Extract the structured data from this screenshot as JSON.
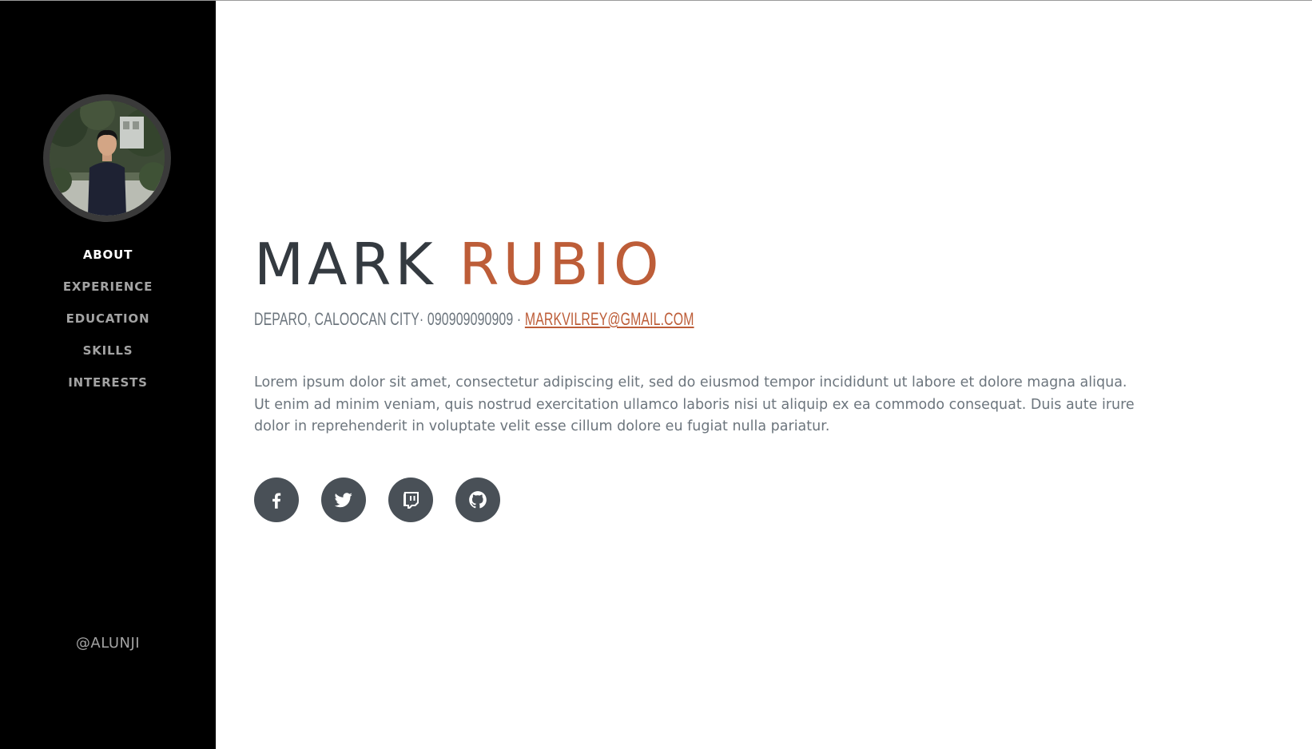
{
  "sidebar": {
    "nav": [
      {
        "label": "ABOUT",
        "active": true
      },
      {
        "label": "EXPERIENCE",
        "active": false
      },
      {
        "label": "EDUCATION",
        "active": false
      },
      {
        "label": "SKILLS",
        "active": false
      },
      {
        "label": "INTERESTS",
        "active": false
      }
    ],
    "handle": "@ALUNJI"
  },
  "about": {
    "first_name": "MARK",
    "last_name": "RUBIO",
    "address": "DEPARO, CALOOCAN CITY· 090909090909 · ",
    "email": "MARKVILREY@GMAIL.COM",
    "intro": "Lorem ipsum dolor sit amet, consectetur adipiscing elit, sed do eiusmod tempor incididunt ut labore et dolore magna aliqua. Ut enim ad minim veniam, quis nostrud exercitation ullamco laboris nisi ut aliquip ex ea commodo consequat. Duis aute irure dolor in reprehenderit in voluptate velit esse cillum dolore eu fugiat nulla pariatur."
  },
  "social": [
    {
      "icon": "facebook-icon"
    },
    {
      "icon": "twitter-icon"
    },
    {
      "icon": "twitch-icon"
    },
    {
      "icon": "github-icon"
    }
  ],
  "colors": {
    "sidebar_bg": "#000000",
    "accent": "#bd5d38",
    "heading": "#343a40",
    "muted": "#6c757d",
    "social_bg": "#495057"
  }
}
